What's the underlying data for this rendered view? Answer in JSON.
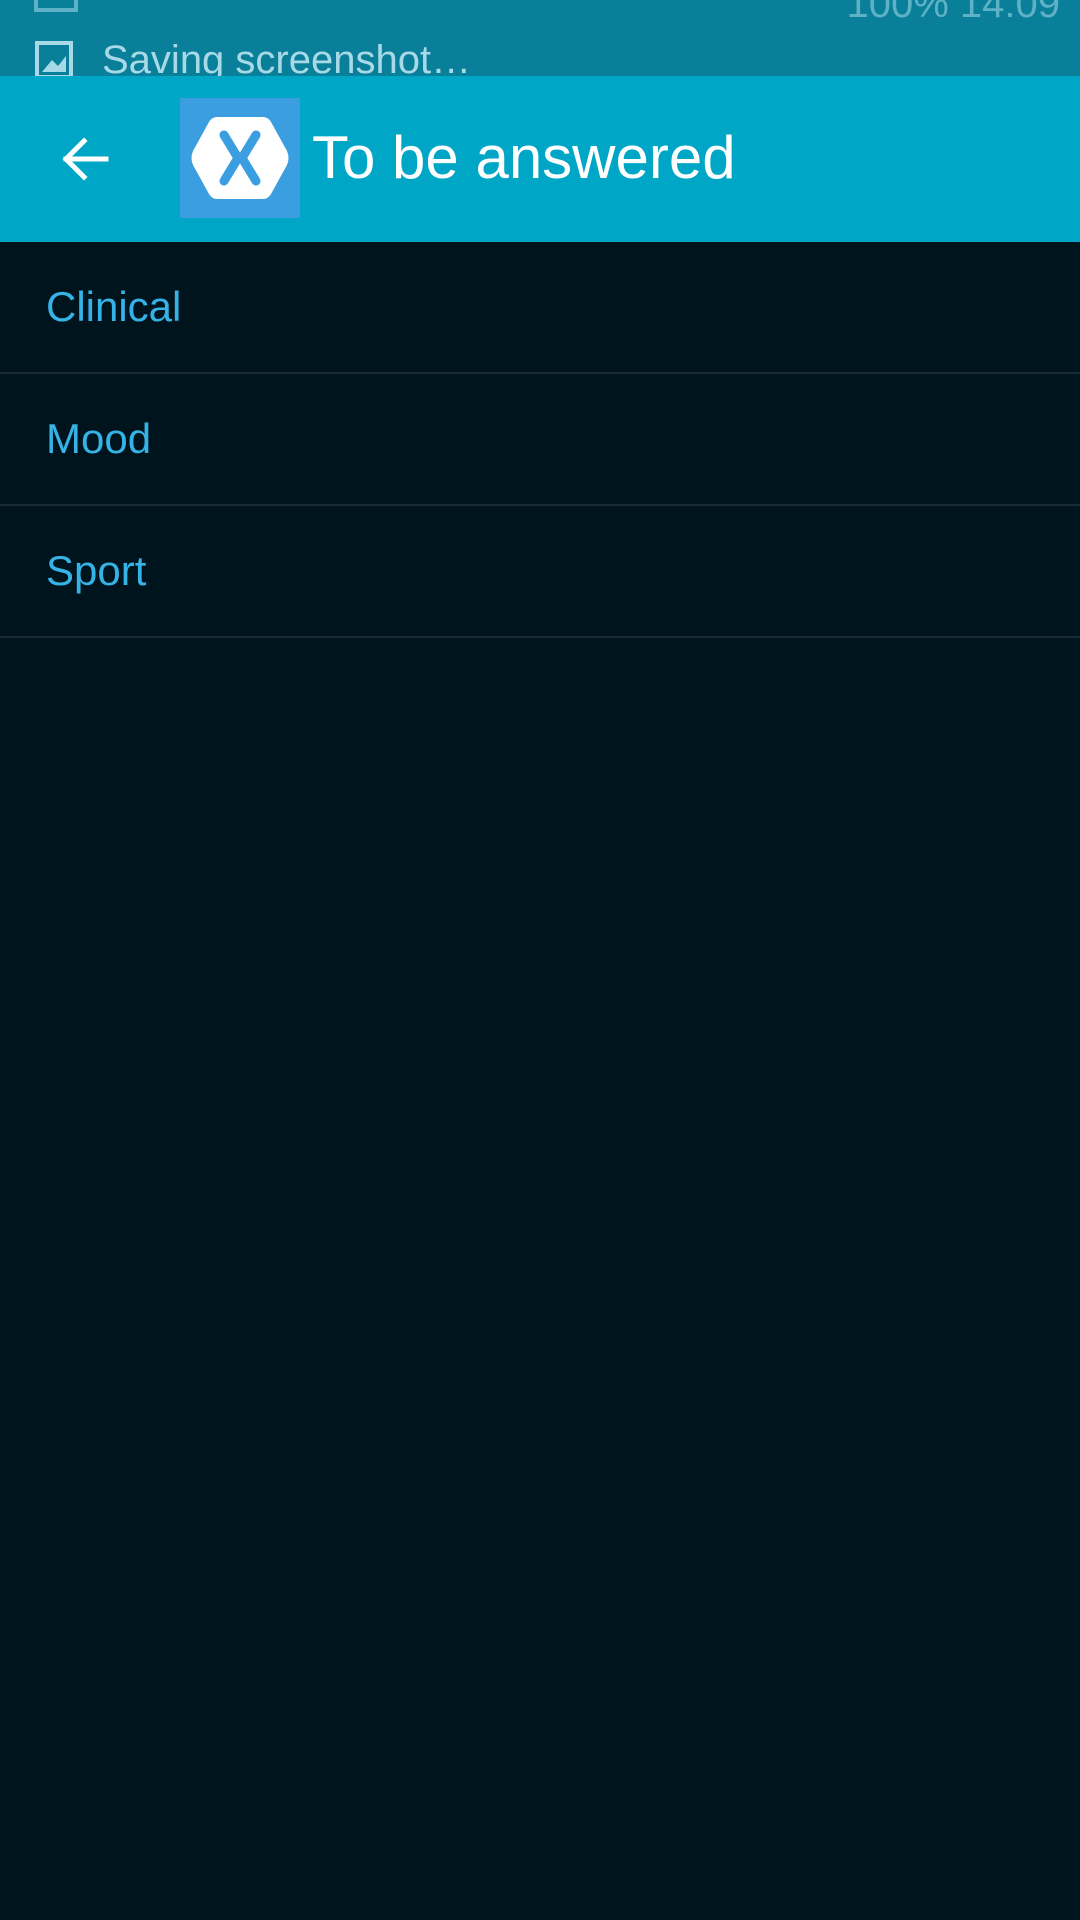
{
  "status_bar": {
    "notification_text": "Saving screenshot…",
    "notification_icon": "image-icon",
    "top_right_partial": "100%  14:09"
  },
  "app_bar": {
    "back_icon": "arrow-left-icon",
    "logo_icon": "xamarin-logo-icon",
    "title": "To be answered",
    "background_color": "#00a6c6"
  },
  "list": {
    "items": [
      {
        "label": "Clinical"
      },
      {
        "label": "Mood"
      },
      {
        "label": "Sport"
      }
    ],
    "text_color": "#36b3e6"
  },
  "colors": {
    "page_background": "#00141d",
    "logo_background": "#3a9ee0"
  }
}
